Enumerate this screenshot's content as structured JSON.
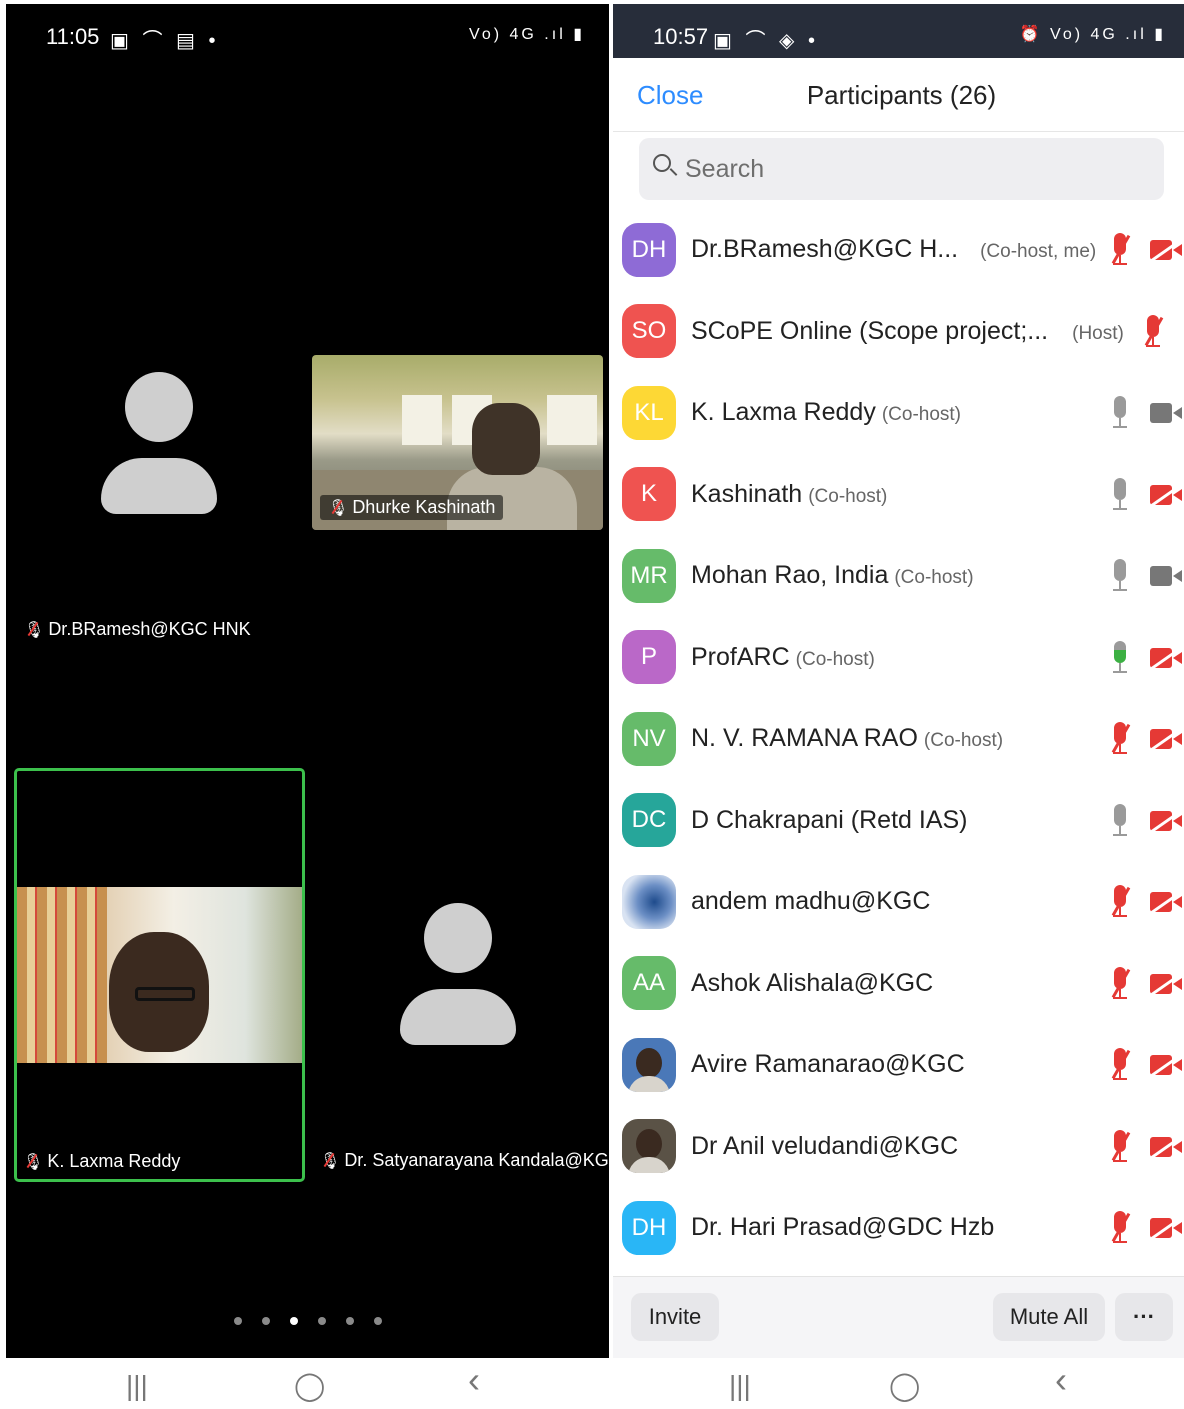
{
  "left": {
    "status": {
      "time": "11:05",
      "left_icons": "▣ ⌒ ▤ •",
      "right_icons": "Vo) 4G .ıl ▮"
    },
    "tiles": {
      "self_name": "Dr.BRamesh@KGC HNK",
      "dhurke_name": "Dhurke Kashinath",
      "laxma_name": "K. Laxma Reddy",
      "satya_name": "Dr. Satyanarayana Kandala@KGC"
    },
    "page_indicator": {
      "count": 6,
      "active_index": 2
    }
  },
  "right": {
    "status": {
      "time": "10:57",
      "left_icons": "▣ ⌒ ◈ •",
      "right_icons": "⏰ Vo) 4G .ıl ▮"
    },
    "header": {
      "close_label": "Close",
      "title": "Participants (26)"
    },
    "search": {
      "placeholder": "Search"
    },
    "participants": [
      {
        "initials": "DH",
        "color": "#8e6bd6",
        "name": "Dr.BRamesh@KGC H...",
        "role": "(Co-host, me)",
        "mic": "muted",
        "cam": "off"
      },
      {
        "initials": "SO",
        "color": "#ef5350",
        "name": "SCoPE Online (Scope project;...",
        "role": "(Host)",
        "mic": "muted",
        "cam": "none"
      },
      {
        "initials": "KL",
        "color": "#fdd835",
        "name": "K. Laxma Reddy",
        "role": "(Co-host)",
        "mic": "on",
        "cam": "on"
      },
      {
        "initials": "K",
        "color": "#ef5350",
        "name": "Kashinath",
        "role": "(Co-host)",
        "mic": "on",
        "cam": "off"
      },
      {
        "initials": "MR",
        "color": "#66bb6a",
        "name": "Mohan Rao, India",
        "role": "(Co-host)",
        "mic": "on",
        "cam": "on"
      },
      {
        "initials": "P",
        "color": "#ba68c8",
        "name": "ProfARC",
        "role": "(Co-host)",
        "mic": "live",
        "cam": "off"
      },
      {
        "initials": "NV",
        "color": "#66bb6a",
        "name": "N. V. RAMANA RAO",
        "role": "(Co-host)",
        "mic": "muted",
        "cam": "off"
      },
      {
        "initials": "DC",
        "color": "#26a69a",
        "name": "D Chakrapani (Retd IAS)",
        "role": "",
        "mic": "on",
        "cam": "off"
      },
      {
        "initials": "",
        "color": "#6c8fc5",
        "name": "andem madhu@KGC",
        "role": "",
        "mic": "muted",
        "cam": "off",
        "avatar": "blur"
      },
      {
        "initials": "AA",
        "color": "#66bb6a",
        "name": "Ashok Alishala@KGC",
        "role": "",
        "mic": "muted",
        "cam": "off"
      },
      {
        "initials": "",
        "color": "#4a78b8",
        "name": "Avire Ramanarao@KGC",
        "role": "",
        "mic": "muted",
        "cam": "off",
        "avatar": "photo"
      },
      {
        "initials": "",
        "color": "#5a5246",
        "name": "Dr Anil veludandi@KGC",
        "role": "",
        "mic": "muted",
        "cam": "off",
        "avatar": "photo"
      },
      {
        "initials": "DH",
        "color": "#29b6f6",
        "name": "Dr. Hari Prasad@GDC Hzb",
        "role": "",
        "mic": "muted",
        "cam": "off"
      }
    ],
    "bottom": {
      "invite_label": "Invite",
      "mute_all_label": "Mute All",
      "more_label": "···"
    }
  },
  "navbar": {
    "recents_glyph": "|||",
    "home_glyph": "◯",
    "back_glyph": "‹"
  }
}
